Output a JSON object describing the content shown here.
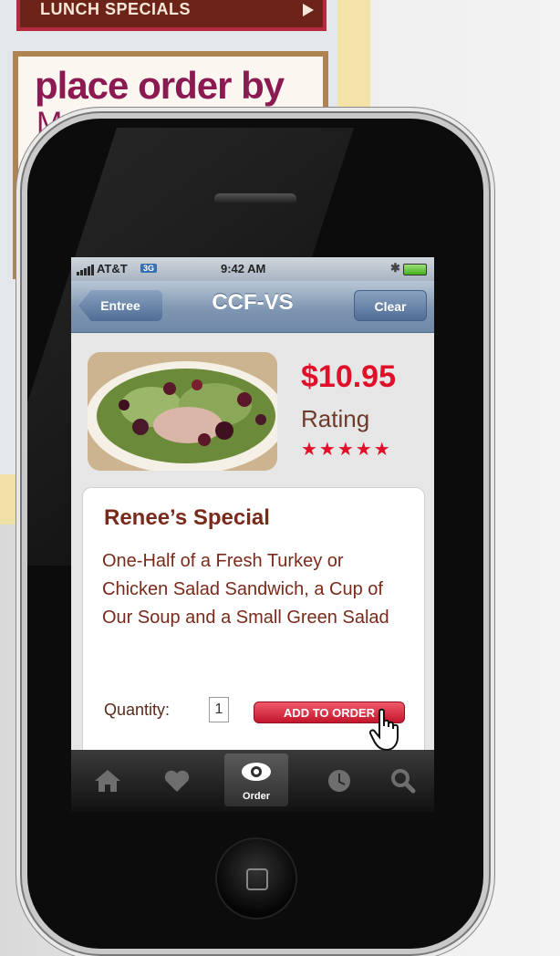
{
  "poster": {
    "banner_label": "LUNCH SPECIALS",
    "place_title": "place order by",
    "place_sub": "Monday"
  },
  "status_bar": {
    "carrier": "AT&T",
    "network": "3G",
    "time": "9:42 AM"
  },
  "nav": {
    "back_label": "Entree",
    "title": "CCF-VS",
    "clear_label": "Clear"
  },
  "product": {
    "price": "$10.95",
    "rating_label": "Rating",
    "stars": "★★★★★",
    "rating_value": 5,
    "name": "Renee’s Special",
    "description": "One-Half of a Fresh Turkey or Chicken Salad Sandwich, a Cup of Our Soup and a Small Green Salad",
    "quantity_label": "Quantity:",
    "quantity_value": "1",
    "add_button_label": "ADD TO ORDER"
  },
  "tabbar": {
    "tabs": [
      {
        "icon": "home-icon"
      },
      {
        "icon": "heart-icon"
      },
      {
        "icon": "eye-icon",
        "label": "Order",
        "active": true
      },
      {
        "icon": "clock-icon"
      },
      {
        "icon": "search-icon"
      }
    ]
  },
  "colors": {
    "price": "#e0102a",
    "nav_bar": "#7f96b1",
    "button": "#c3152c",
    "text_brown": "#7a2a1a"
  }
}
